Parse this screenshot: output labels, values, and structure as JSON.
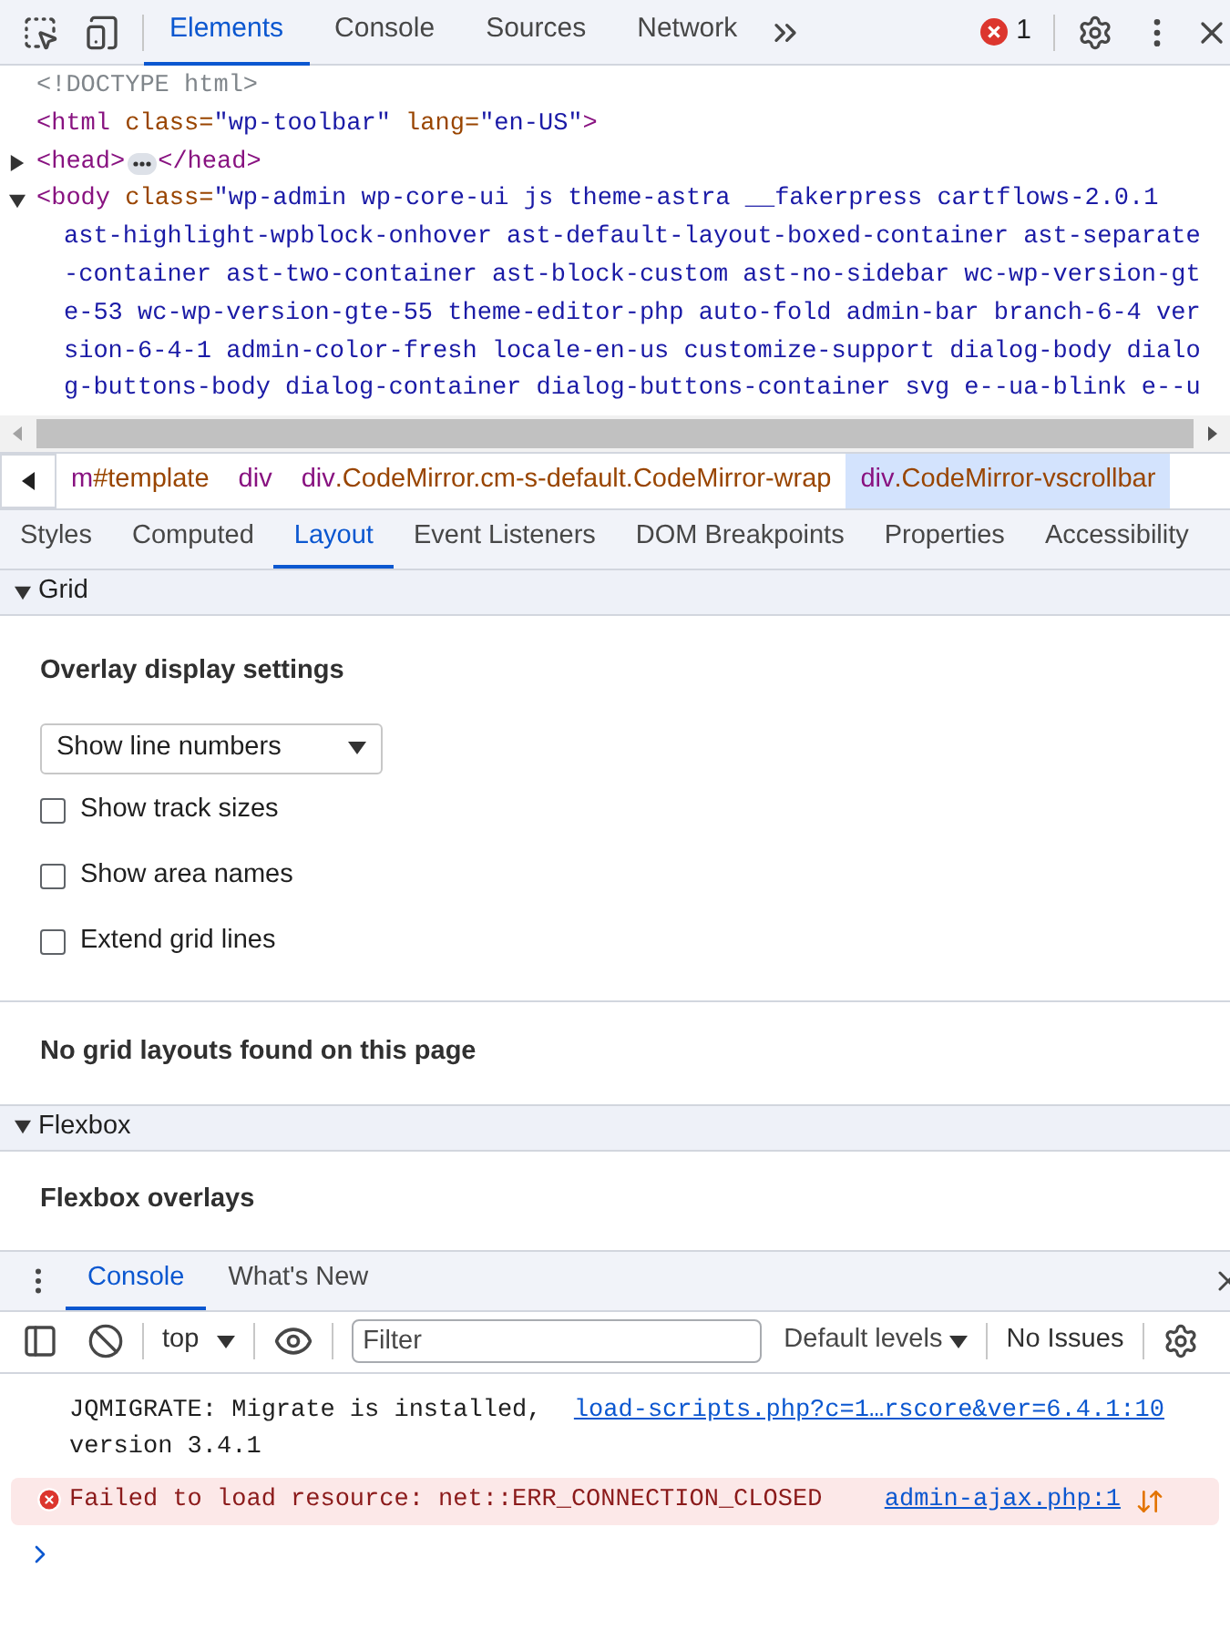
{
  "toolbar": {
    "tabs": [
      {
        "label": "Elements",
        "selected": true
      },
      {
        "label": "Console",
        "selected": false
      },
      {
        "label": "Sources",
        "selected": false
      },
      {
        "label": "Network",
        "selected": false
      }
    ],
    "error_count": "1"
  },
  "dom_lines": [
    {
      "kind": "text",
      "segments": [
        {
          "kind": "doctype",
          "text": "<!DOCTYPE html>"
        }
      ]
    },
    {
      "kind": "text",
      "segments": [
        {
          "kind": "tag",
          "text": "<html"
        },
        {
          "kind": "attr",
          "text": " class="
        },
        {
          "kind": "value",
          "text": "\"wp-toolbar\""
        },
        {
          "kind": "attr",
          "text": " lang="
        },
        {
          "kind": "value",
          "text": "\"en-US\""
        },
        {
          "kind": "tag",
          "text": ">"
        }
      ]
    },
    {
      "kind": "node",
      "expanded": false,
      "segments": [
        {
          "kind": "tag",
          "text": "<head>"
        },
        {
          "kind": "ellipsis"
        },
        {
          "kind": "tag",
          "text": "</head>"
        }
      ]
    },
    {
      "kind": "node",
      "expanded": true,
      "segments": [
        {
          "kind": "tag",
          "text": "<body"
        },
        {
          "kind": "attr",
          "text": " class="
        },
        {
          "kind": "value",
          "text": "\"wp-admin wp-core-ui js theme-astra __fakerpress cartflows-2.0.1"
        }
      ]
    },
    {
      "kind": "continuation",
      "segments": [
        {
          "kind": "value",
          "text": "ast-highlight-wpblock-onhover ast-default-layout-boxed-container ast-separate"
        }
      ]
    },
    {
      "kind": "continuation",
      "segments": [
        {
          "kind": "value",
          "text": "-container ast-two-container ast-block-custom ast-no-sidebar wc-wp-version-gt"
        }
      ]
    },
    {
      "kind": "continuation",
      "segments": [
        {
          "kind": "value",
          "text": "e-53 wc-wp-version-gte-55 theme-editor-php auto-fold admin-bar branch-6-4 ver"
        }
      ]
    },
    {
      "kind": "continuation",
      "segments": [
        {
          "kind": "value",
          "text": "sion-6-4-1 admin-color-fresh locale-en-us customize-support dialog-body dialo"
        }
      ]
    },
    {
      "kind": "continuation",
      "segments": [
        {
          "kind": "value",
          "text": "g-buttons-body dialog-container dialog-buttons-container svg e--ua-blink e--u"
        }
      ]
    }
  ],
  "breadcrumbs": [
    {
      "tag": "m",
      "rest": "#template",
      "selected": false
    },
    {
      "tag": "div",
      "selected": false
    },
    {
      "tag": "div",
      "rest": ".CodeMirror.cm-s-default.CodeMirror-wrap",
      "selected": false
    },
    {
      "tag": "div",
      "rest": ".CodeMirror-vscrollbar",
      "selected": true
    }
  ],
  "sub_tabs": [
    {
      "label": "Styles",
      "selected": false
    },
    {
      "label": "Computed",
      "selected": false
    },
    {
      "label": "Layout",
      "selected": true
    },
    {
      "label": "Event Listeners",
      "selected": false
    },
    {
      "label": "DOM Breakpoints",
      "selected": false
    },
    {
      "label": "Properties",
      "selected": false
    },
    {
      "label": "Accessibility",
      "selected": false
    }
  ],
  "grid": {
    "title": "Grid",
    "expanded": true,
    "settings_title": "Overlay display settings",
    "select_value": "Show line numbers",
    "checkboxes": [
      {
        "label": "Show track sizes",
        "checked": false
      },
      {
        "label": "Show area names",
        "checked": false
      },
      {
        "label": "Extend grid lines",
        "checked": false
      }
    ],
    "empty_message": "No grid layouts found on this page"
  },
  "flexbox": {
    "title": "Flexbox",
    "expanded": true,
    "overlays_title": "Flexbox overlays"
  },
  "drawer": {
    "tabs": [
      {
        "label": "Console",
        "selected": true
      },
      {
        "label": "What's New",
        "selected": false
      }
    ],
    "context": "top",
    "filter_placeholder": "Filter",
    "levels": "Default levels",
    "issues": "No Issues",
    "messages": [
      {
        "kind": "info",
        "text": "JQMIGRATE: Migrate is installed, version 3.4.1",
        "source": "load-scripts.php?c=1…rscore&ver=6.4.1:10"
      },
      {
        "kind": "error",
        "text": "Failed to load resource: net::ERR_CONNECTION_CLOSED",
        "source": "admin-ajax.php:1"
      }
    ]
  }
}
